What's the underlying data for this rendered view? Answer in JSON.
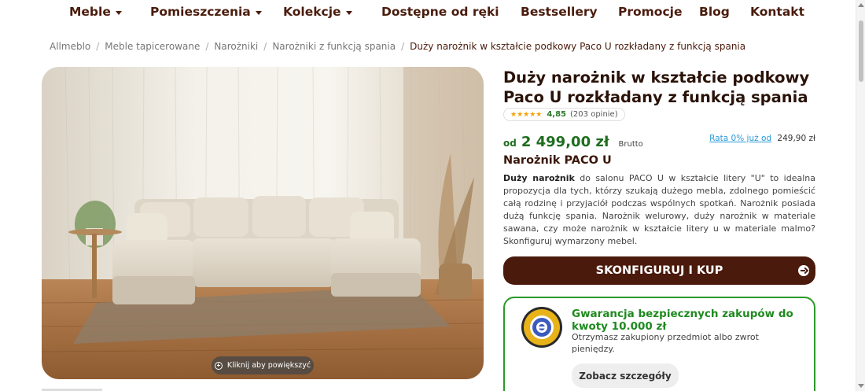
{
  "nav": {
    "items": [
      {
        "label": "Meble",
        "has_dropdown": true
      },
      {
        "label": "Pomieszczenia",
        "has_dropdown": true
      },
      {
        "label": "Kolekcje",
        "has_dropdown": true
      },
      {
        "label": "Dostępne od ręki",
        "has_dropdown": false
      },
      {
        "label": "Bestsellery",
        "has_dropdown": false
      },
      {
        "label": "Promocje",
        "has_dropdown": false
      },
      {
        "label": "Blog",
        "has_dropdown": false
      },
      {
        "label": "Kontakt",
        "has_dropdown": false
      }
    ]
  },
  "breadcrumb": {
    "items": [
      "Allmeblo",
      "Meble tapicerowane",
      "Narożniki",
      "Narożniki z funkcją spania"
    ],
    "current": "Duży narożnik w kształcie podkowy Paco U rozkładany z funkcją spania"
  },
  "gallery": {
    "zoom_label": "Kliknij aby powiększyć",
    "zoom_icon": "zoom-in-icon"
  },
  "product": {
    "title": "Duży narożnik w kształcie podkowy Paco U rozkładany z funkcją spania",
    "rating": {
      "stars": "★★★★★",
      "score": "4,85",
      "count": "(203 opinie)"
    },
    "price": {
      "prefix": "od",
      "value": "2 499,00 zł",
      "note": "Brutto"
    },
    "installment": {
      "link": "Rata 0% już od",
      "amount": "249,90 zł"
    },
    "subtitle": "Narożnik PACO U",
    "description": {
      "lead": "Duży narożnik",
      "body": " do salonu PACO U w kształcie litery \"U\" to idealna propozycja dla tych, którzy szukają dużego mebla, zdolnego pomieścić całą rodzinę i przyjaciół podczas wspólnych spotkań. Narożnik posiada dużą funkcję spania. Narożnik welurowy, duży narożnik w materiale sawana, czy może narożnik w kształcie litery u w materiale malmo? Skonfiguruj wymarzony mebel."
    },
    "cta_label": "SKONFIGURUJ I KUP",
    "cta_icon": "arrow-right-circle-icon"
  },
  "guarantee": {
    "badge_icon": "trusted-shops-badge-icon",
    "title": "Gwarancja bezpiecznych zakupów do kwoty 10.000 zł",
    "text": "Otrzymasz zakupiony przedmiot albo zwrot pieniędzy.",
    "button_label": "Zobacz szczegóły"
  },
  "colors": {
    "brand_brown": "#4a1a0c",
    "price_green": "#1f6d1f",
    "guarantee_green": "#2a9a2a",
    "link_blue": "#2a9ad8"
  }
}
